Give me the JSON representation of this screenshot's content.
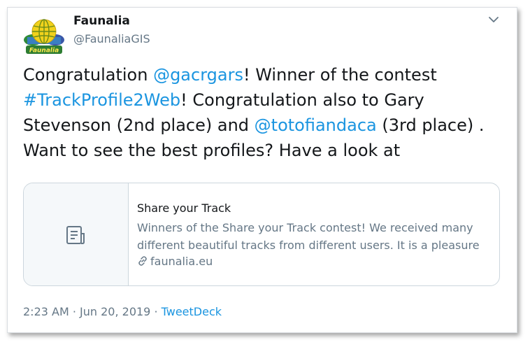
{
  "author": {
    "display_name": "Faunalia",
    "handle": "@FaunaliaGIS",
    "logo_text": "Faunalia"
  },
  "tweet": {
    "parts": [
      {
        "text": "Congratulation ",
        "link": false
      },
      {
        "text": "@gacrgars",
        "link": true
      },
      {
        "text": "! Winner of the contest ",
        "link": false
      },
      {
        "text": "#TrackProfile2Web",
        "link": true
      },
      {
        "text": "! Congratulation also to Gary Stevenson (2nd place) and ",
        "link": false
      },
      {
        "text": "@totofiandaca",
        "link": true
      },
      {
        "text": " (3rd place) . Want to see the best profiles? Have a look at",
        "link": false
      }
    ]
  },
  "card": {
    "title": "Share your Track",
    "description": "Winners of the Share your Track contest! We received many different beautiful tracks from different users. It is a pleasure",
    "domain": "faunalia.eu"
  },
  "meta": {
    "timestamp": "2:23 AM · Jun 20, 2019",
    "separator": " · ",
    "source": "TweetDeck"
  },
  "colors": {
    "link": "#1b95e0",
    "text": "#14171a",
    "secondary": "#657786",
    "border": "#ccd6dd"
  },
  "icons": {
    "menu": "chevron-down-icon",
    "card_thumbnail": "document-icon",
    "domain": "link-icon"
  }
}
